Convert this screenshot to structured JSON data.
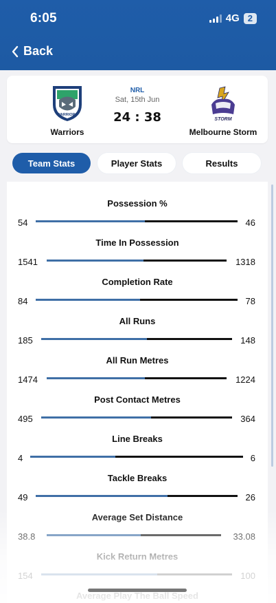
{
  "status_bar": {
    "time": "6:05",
    "network": "4G",
    "battery": "2"
  },
  "nav": {
    "back_label": "Back"
  },
  "match": {
    "competition": "NRL",
    "date": "Sat, 15th Jun",
    "score": "24 : 38",
    "home_team": "Warriors",
    "away_team": "Melbourne Storm",
    "home_logo_text": "WARRIORS",
    "away_logo_text": "STORM"
  },
  "tabs": [
    {
      "label": "Team Stats",
      "active": true
    },
    {
      "label": "Player Stats",
      "active": false
    },
    {
      "label": "Results",
      "active": false
    }
  ],
  "stats": [
    {
      "title": "Possession %",
      "home": "54",
      "away": "46"
    },
    {
      "title": "Time In Possession",
      "home": "1541",
      "away": "1318"
    },
    {
      "title": "Completion Rate",
      "home": "84",
      "away": "78"
    },
    {
      "title": "All Runs",
      "home": "185",
      "away": "148"
    },
    {
      "title": "All Run Metres",
      "home": "1474",
      "away": "1224"
    },
    {
      "title": "Post Contact Metres",
      "home": "495",
      "away": "364"
    },
    {
      "title": "Line Breaks",
      "home": "4",
      "away": "6"
    },
    {
      "title": "Tackle Breaks",
      "home": "49",
      "away": "26"
    },
    {
      "title": "Average Set Distance",
      "home": "38.8",
      "away": "33.08"
    },
    {
      "title": "Kick Return Metres",
      "home": "154",
      "away": "100"
    },
    {
      "title": "Average Play The Ball Speed",
      "home": "",
      "away": ""
    }
  ],
  "colors": {
    "brand": "#1f5da9",
    "home_bar": "#3f6fa6",
    "away_bar": "#111111"
  }
}
